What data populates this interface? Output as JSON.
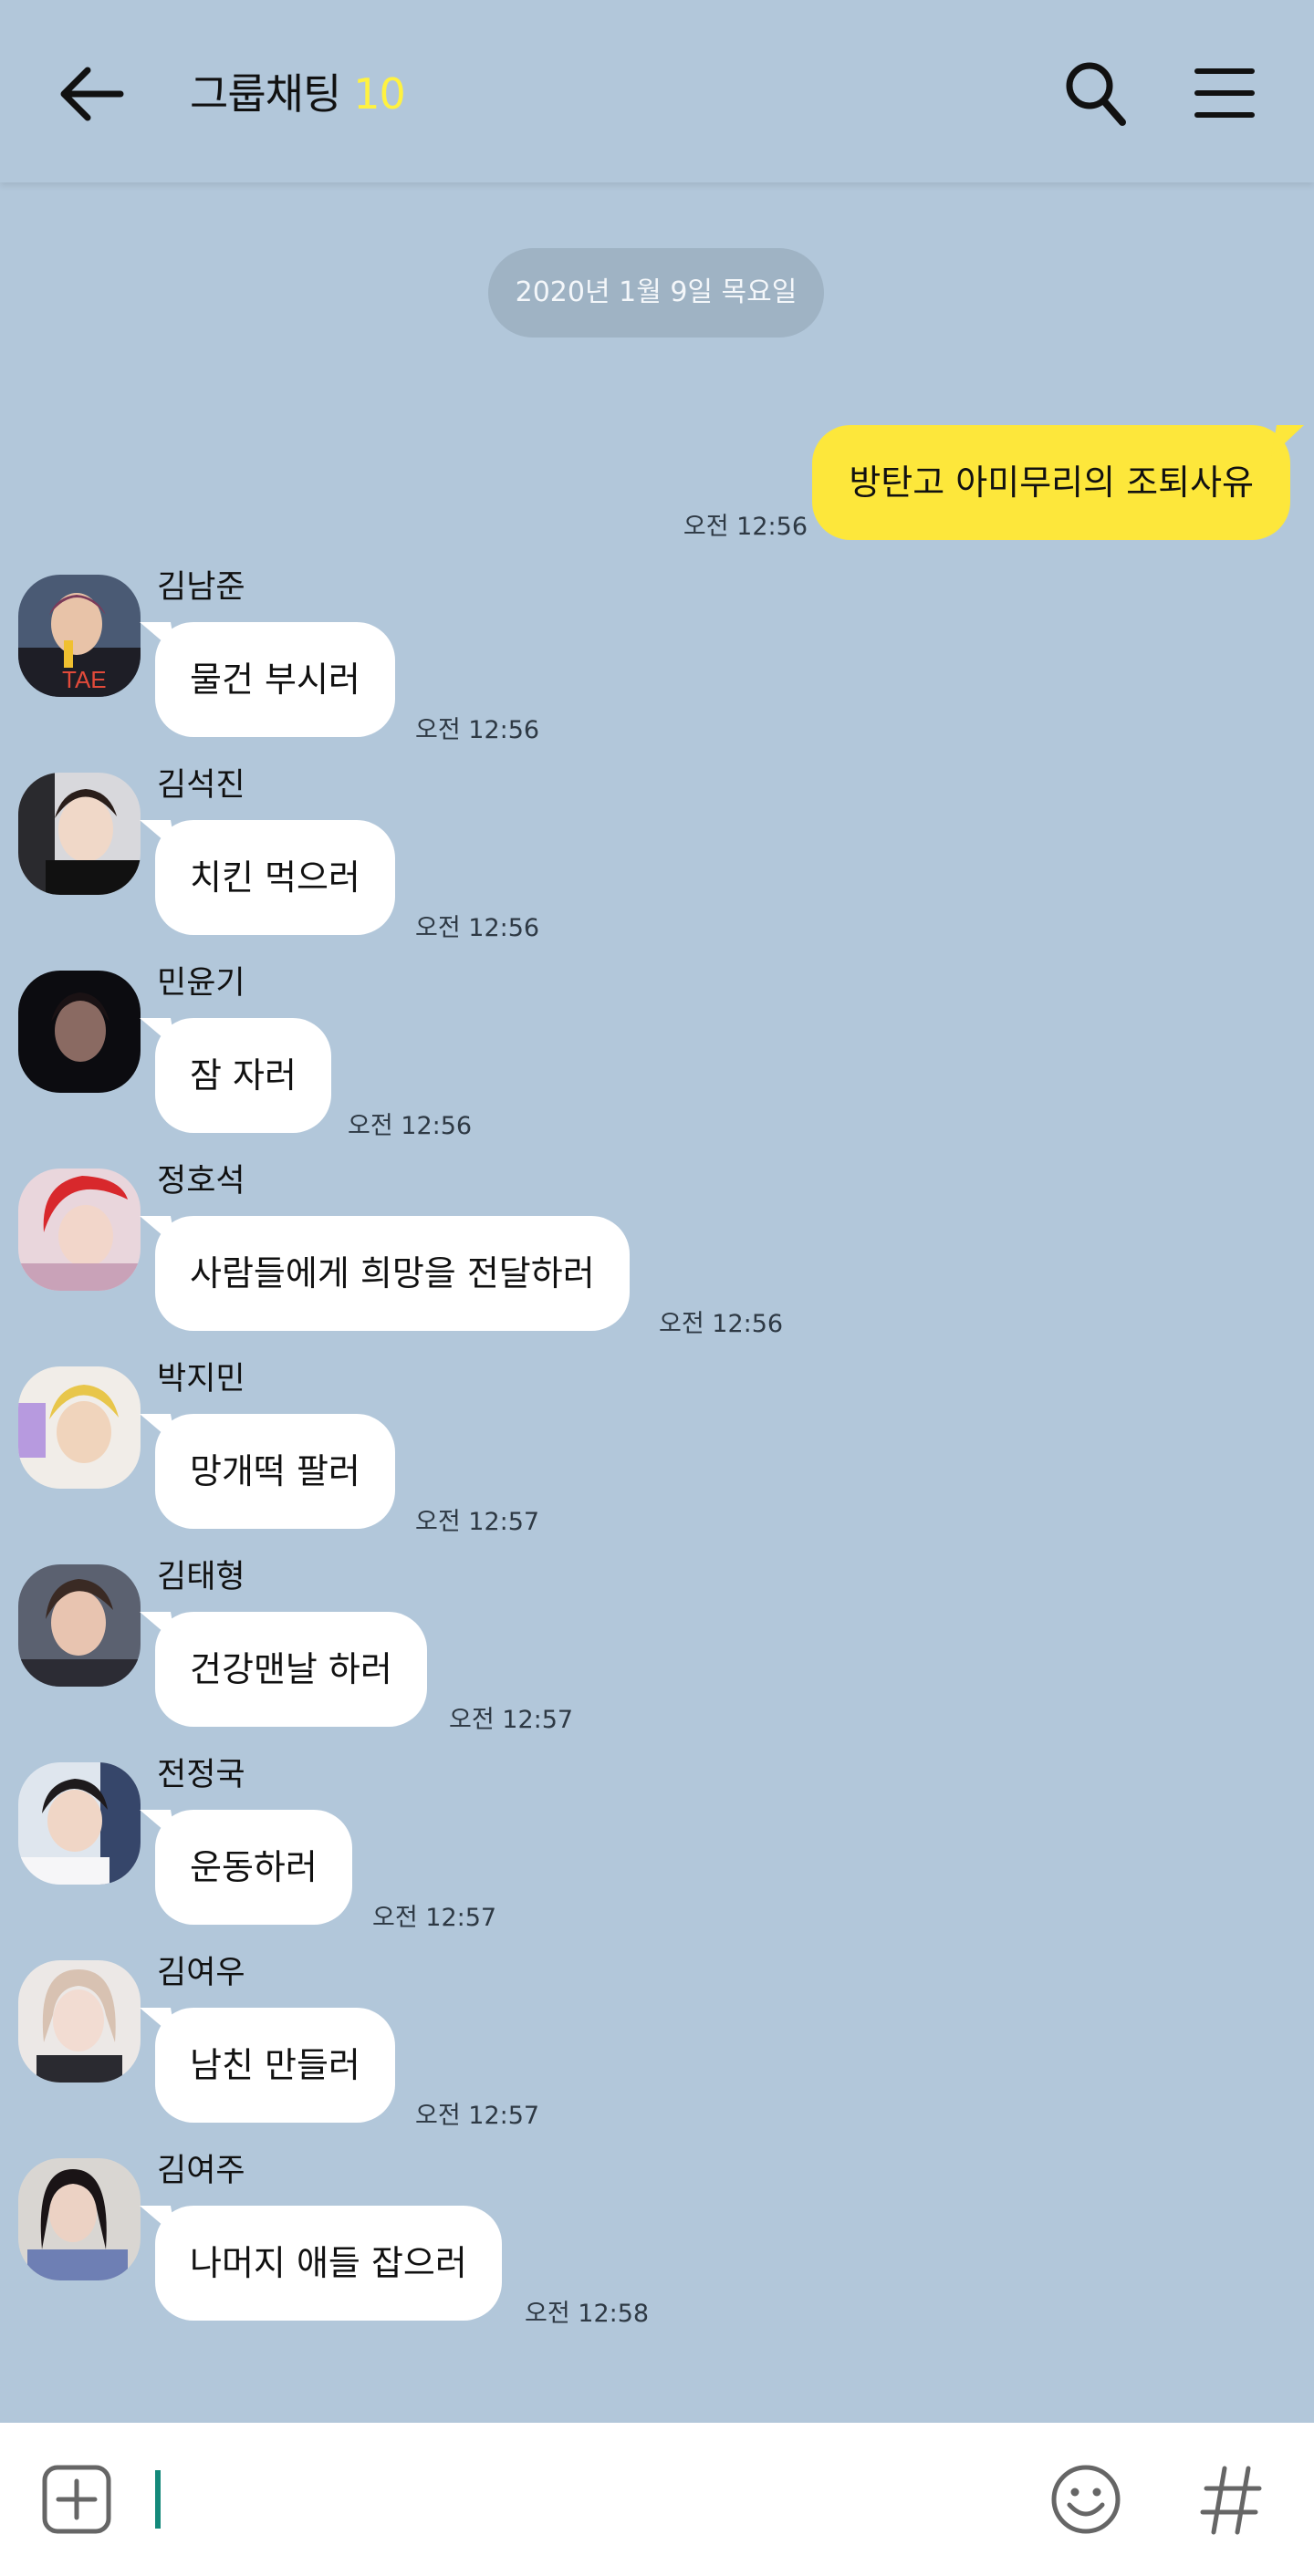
{
  "header": {
    "title": "그룹채팅",
    "member_count": "10",
    "back_icon": "arrow-left-icon",
    "search_icon": "search-icon",
    "menu_icon": "hamburger-menu-icon"
  },
  "date_divider": "2020년 1월 9일 목요일",
  "my_message": {
    "text": "방탄고 아미무리의 조퇴사유",
    "time": "오전 12:56"
  },
  "messages": [
    {
      "name": "김남준",
      "text": "물건 부시러",
      "time": "오전 12:56"
    },
    {
      "name": "김석진",
      "text": "치킨 먹으러",
      "time": "오전 12:56"
    },
    {
      "name": "민윤기",
      "text": "잠 자러",
      "time": "오전 12:56"
    },
    {
      "name": "정호석",
      "text": "사람들에게 희망을 전달하러",
      "time": "오전 12:56"
    },
    {
      "name": "박지민",
      "text": "망개떡 팔러",
      "time": "오전 12:57"
    },
    {
      "name": "김태형",
      "text": "건강맨날 하러",
      "time": "오전 12:57"
    },
    {
      "name": "전정국",
      "text": "운동하러",
      "time": "오전 12:57"
    },
    {
      "name": "김여우",
      "text": "남친 만들러",
      "time": "오전 12:57"
    },
    {
      "name": "김여주",
      "text": "나머지 애들 잡으러",
      "time": "오전 12:58"
    }
  ],
  "composer": {
    "plus_icon": "plus-square-icon",
    "emoji_icon": "smiley-icon",
    "hash_icon": "hashtag-icon"
  },
  "colors": {
    "background": "#b2c7da",
    "my_bubble": "#fde73b",
    "member_count": "#fff240",
    "caret": "#14897a"
  }
}
